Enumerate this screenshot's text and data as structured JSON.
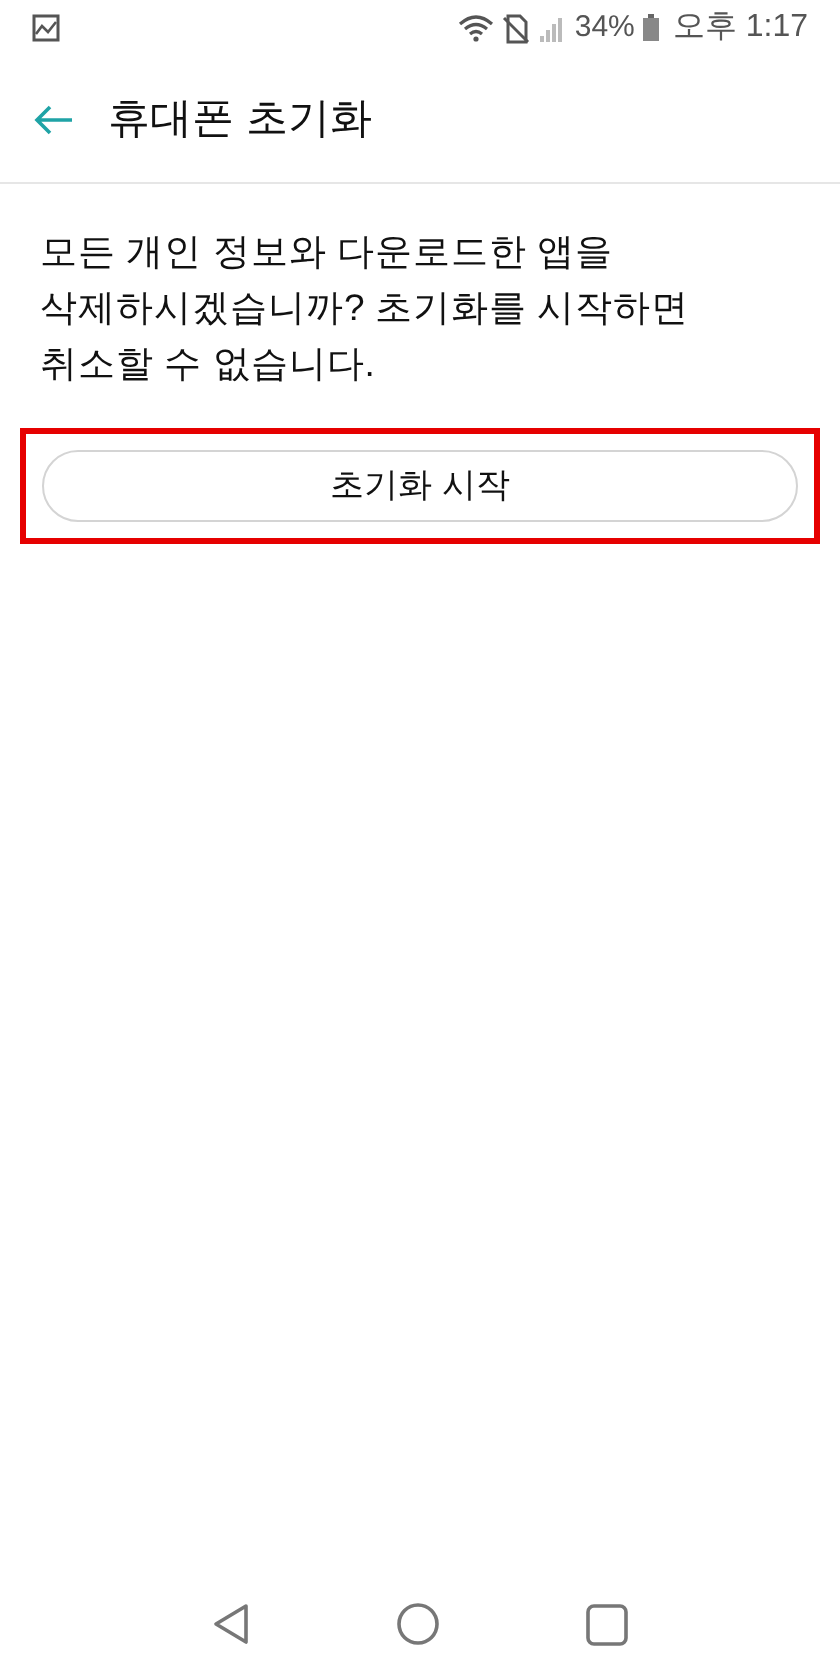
{
  "status_bar": {
    "battery": "34%",
    "time": "오후 1:17"
  },
  "app_bar": {
    "title": "휴대폰 초기화"
  },
  "message": "모든 개인 정보와 다운로드한 앱을 삭제하시겠습니까? 초기화를 시작하면 취소할 수 없습니다.",
  "reset_button": {
    "label": "초기화 시작",
    "highlighted": true
  }
}
